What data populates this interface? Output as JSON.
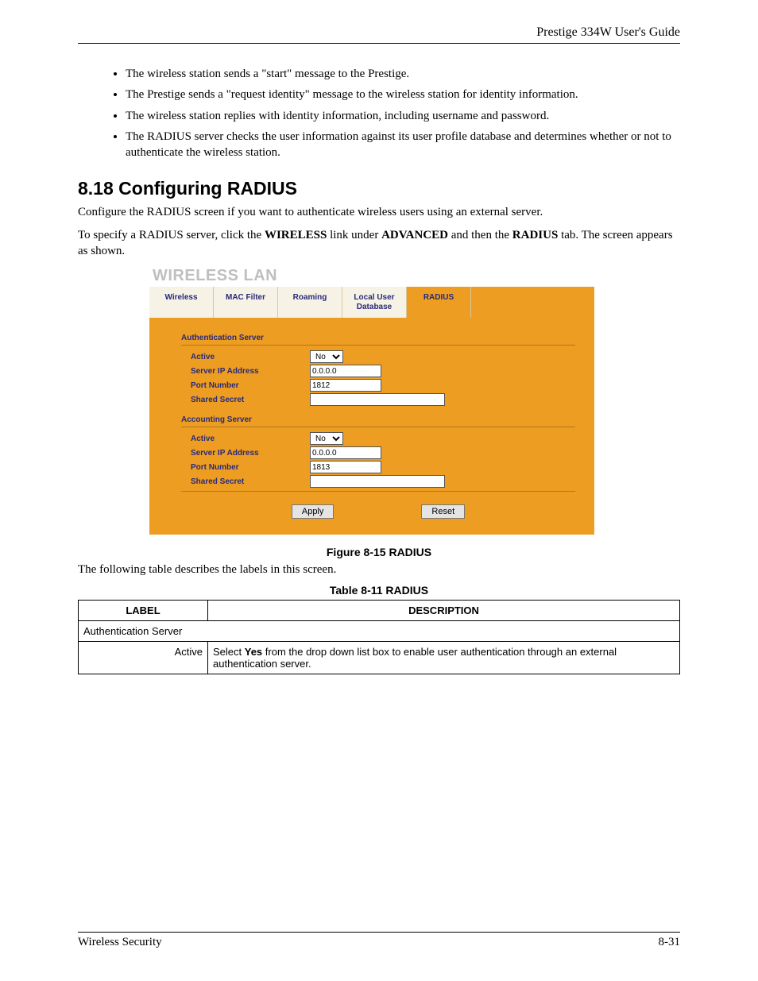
{
  "header": {
    "guide": "Prestige 334W User's Guide"
  },
  "bullets": [
    "The wireless station sends a \"start\" message to the Prestige.",
    "The Prestige sends a \"request identity\" message to the wireless station for identity information.",
    "The wireless station replies with identity information, including username and password.",
    "The RADIUS server checks the user information against its user profile database and determines whether or not to authenticate the wireless station."
  ],
  "section": {
    "title": "8.18  Configuring RADIUS",
    "p1": "Configure the RADIUS screen if you want to authenticate wireless users using an external server.",
    "p2a": "To specify a RADIUS server, click the ",
    "p2b": "WIRELESS",
    "p2c": " link under ",
    "p2d": "ADVANCED",
    "p2e": " and then the ",
    "p2f": "RADIUS",
    "p2g": " tab. The screen appears as shown."
  },
  "screenshot": {
    "title": "WIRELESS LAN",
    "tabs": [
      "Wireless",
      "MAC Filter",
      "Roaming",
      "Local User Database",
      "RADIUS"
    ],
    "activeTab": 4,
    "auth": {
      "head": "Authentication Server",
      "active_label": "Active",
      "active_value": "No",
      "ip_label": "Server IP Address",
      "ip_value": "0.0.0.0",
      "port_label": "Port Number",
      "port_value": "1812",
      "secret_label": "Shared Secret",
      "secret_value": ""
    },
    "acct": {
      "head": "Accounting Server",
      "active_label": "Active",
      "active_value": "No",
      "ip_label": "Server IP Address",
      "ip_value": "0.0.0.0",
      "port_label": "Port Number",
      "port_value": "1813",
      "secret_label": "Shared Secret",
      "secret_value": ""
    },
    "buttons": {
      "apply": "Apply",
      "reset": "Reset"
    }
  },
  "figure_caption": "Figure 8-15 RADIUS",
  "table_intro": "The following table describes the labels in this screen.",
  "table_caption": "Table 8-11 RADIUS",
  "table": {
    "h1": "LABEL",
    "h2": "DESCRIPTION",
    "rows": [
      {
        "label": "Authentication Server",
        "desc": "",
        "span": true
      },
      {
        "label": "Active",
        "desc_pre": "Select ",
        "desc_bold": "Yes",
        "desc_post": " from the drop down list box to enable user authentication through an external authentication server."
      }
    ]
  },
  "footer": {
    "left": "Wireless Security",
    "right": "8-31"
  }
}
